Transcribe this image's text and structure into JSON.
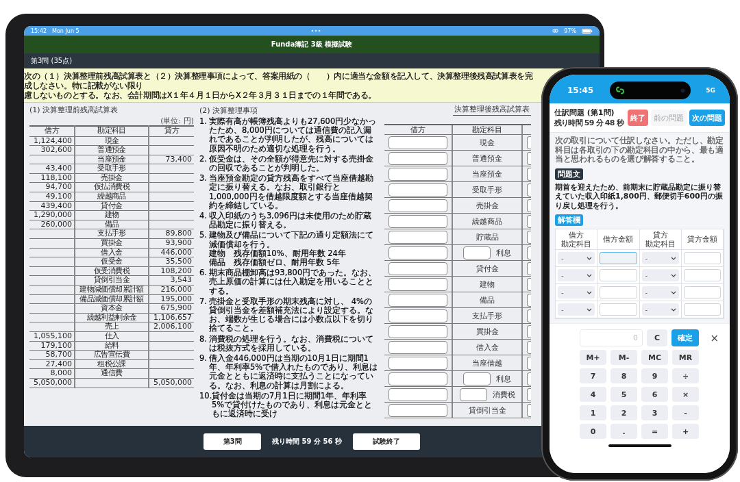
{
  "ipad": {
    "status_bar": {
      "time": "15:42",
      "date": "Mon Jun 5",
      "battery": "97%"
    },
    "app_title": "Funda簿記 3級 模擬試験",
    "section_title": "第3問 (35点)",
    "instructions": [
      "次の（１）決算整理前残高試算表と（２）決算整理事項によって、答案用紙の（　　）内に適当な金額を記入して、決算整理後残高試算表を完成しなさい。特に記載がない限り",
      "慮しないものとする。なお、会計期間はX１年４月１日からX２年３月３１日までの１年間である。"
    ],
    "trial_balance": {
      "title": "(1) 決算整理前残高試算表",
      "unit": "(単位: 円)",
      "columns": [
        "借方",
        "勘定科目",
        "貸方"
      ],
      "rows": [
        {
          "debit": "1,124,400",
          "account": "現金"
        },
        {
          "debit": "302,600",
          "account": "普通預金"
        },
        {
          "account": "当座預金",
          "credit": "73,400"
        },
        {
          "debit": "43,400",
          "account": "受取手形"
        },
        {
          "debit": "118,100",
          "account": "売掛金"
        },
        {
          "debit": "94,700",
          "account": "仮払消費税"
        },
        {
          "debit": "49,100",
          "account": "繰越商品"
        },
        {
          "debit": "439,400",
          "account": "貸付金"
        },
        {
          "debit": "1,290,000",
          "account": "建物"
        },
        {
          "debit": "260,000",
          "account": "備品"
        },
        {
          "account": "支払手形",
          "credit": "89,800"
        },
        {
          "account": "買掛金",
          "credit": "93,900"
        },
        {
          "account": "借入金",
          "credit": "446,000"
        },
        {
          "account": "仮受金",
          "credit": "35,500"
        },
        {
          "account": "仮受消費税",
          "credit": "108,200"
        },
        {
          "account": "貸倒引当金",
          "credit": "3,543"
        },
        {
          "account": "建物減価償却累計額",
          "credit": "216,000"
        },
        {
          "account": "備品減価償却累計額",
          "credit": "195,000"
        },
        {
          "account": "資本金",
          "credit": "675,900"
        },
        {
          "account": "繰越利益剰余金",
          "credit": "1,106,657"
        },
        {
          "account": "売上",
          "credit": "2,006,100"
        },
        {
          "debit": "1,055,100",
          "account": "仕入"
        },
        {
          "debit": "179,100",
          "account": "給料"
        },
        {
          "debit": "58,700",
          "account": "広告宣伝費"
        },
        {
          "debit": "27,400",
          "account": "租税公課"
        },
        {
          "debit": "8,000",
          "account": "通信費"
        },
        {
          "debit": "5,050,000",
          "credit": "5,050,000"
        }
      ]
    },
    "adjustments": {
      "title": "(2) 決算整理事項",
      "items": [
        {
          "number": "1.",
          "text": "実際有高が帳簿残高よりも27,600円少なかったため、8,000円については通信費の記入漏れであることが判明したが、残高については原因不明のため適切な処理を行う。"
        },
        {
          "number": "2.",
          "text": "仮受金は、その全額が得意先に対する売掛金の回収であることが判明した。"
        },
        {
          "number": "3.",
          "text": "当座預金勘定の貸方残高をすべて当座借越勘定に振り替える。なお、取引銀行と1,000,000円を借越限度額とする当座借越契約を締結している。"
        },
        {
          "number": "4.",
          "text": "収入印紙のうち3,096円は未使用のため貯蔵品勘定に振り替える。"
        },
        {
          "number": "5.",
          "text": "建物及び備品について下記の通り定額法にて減価償却を行う。",
          "details": [
            "建物　残存価額10%、耐用年数 24年",
            "備品　残存価額ゼロ、耐用年数 5年"
          ]
        },
        {
          "number": "6.",
          "text": "期末商品棚卸高は93,800円であった。なお、売上原価の計算には仕入勘定を用いることとする。"
        },
        {
          "number": "7.",
          "text": "売掛金と受取手形の期末残高に対し、 4%の貸倒引当金を差額補充法により設定する。なお、端数が生じる場合には小数点以下を切り捨てること。"
        },
        {
          "number": "8.",
          "text": "消費税の処理を行う。なお、消費税については税抜方式を採用している。"
        },
        {
          "number": "9.",
          "text": "借入金446,000円は当期の10月1日に期間1年、年利率5%で借入れたものであり、利息は元金とともに返済時に支払うことになっている。なお、利息の計算は月割による。"
        },
        {
          "number": "10.",
          "text": "貸付金は当期の7月1日に期間1年、年利率5%で貸付けたものであり、利息は元金とともに返済時に受け"
        }
      ]
    },
    "answer_sheet": {
      "title": "決算整理後残高試算表",
      "columns": [
        "借方",
        "勘定科目"
      ],
      "rows": [
        {
          "kind": "plain",
          "account": "現金"
        },
        {
          "kind": "plain",
          "account": "普通預金"
        },
        {
          "kind": "plain",
          "account": "当座預金"
        },
        {
          "kind": "plain",
          "account": "受取手形"
        },
        {
          "kind": "plain",
          "account": "売掛金"
        },
        {
          "kind": "plain",
          "account": "繰越商品"
        },
        {
          "kind": "plain",
          "account": "貯蔵品"
        },
        {
          "kind": "with_input",
          "account": "利息"
        },
        {
          "kind": "plain",
          "account": "貸付金"
        },
        {
          "kind": "plain",
          "account": "建物"
        },
        {
          "kind": "plain",
          "account": "備品"
        },
        {
          "kind": "plain",
          "account": "支払手形"
        },
        {
          "kind": "plain",
          "account": "買掛金"
        },
        {
          "kind": "plain",
          "account": "借入金"
        },
        {
          "kind": "plain",
          "account": "当座借越"
        },
        {
          "kind": "with_input",
          "account": "利息"
        },
        {
          "kind": "with_input",
          "account": "消費税"
        },
        {
          "kind": "plain",
          "account": "貸倒引当金"
        }
      ]
    },
    "footer": {
      "section_button": "第3問",
      "time_left": "残り時間 59 分 56 秒",
      "end_button": "試験終了"
    }
  },
  "iphone": {
    "status_bar": {
      "time": "15:45",
      "network": "5G"
    },
    "title": "仕訳問題 (第1問)",
    "time_left": "残り時間 59 分 48 秒",
    "buttons": [
      {
        "label": "終了",
        "kind": "danger",
        "disabled": false
      },
      {
        "label": "前の問題",
        "kind": "secondary",
        "disabled": true
      },
      {
        "label": "次の問題",
        "kind": "primary",
        "disabled": false
      }
    ],
    "instruction": "次の取引について仕訳しなさい。ただし、勘定科目は各取引の下の勘定科目の中から、最も適当と思われるものを選び解答すること。",
    "question_tag": "問題文",
    "question": "期首を迎えたため、前期末に貯蔵品勘定に振り替えていた収入印紙1,800円、郵便切手600円の振り戻し処理を行う。",
    "answer_tag": "解答欄",
    "answer_columns": [
      [
        "借方",
        "勘定科目"
      ],
      [
        "借方金額"
      ],
      [
        "貸方",
        "勘定科目"
      ],
      [
        "貸方金額"
      ]
    ],
    "answer_rows": [
      {
        "debit_account": "-",
        "debit_amount_focused": true,
        "credit_account": "-"
      },
      {
        "debit_account": "-",
        "debit_amount_focused": false,
        "credit_account": "-"
      },
      {
        "debit_account": "-",
        "debit_amount_focused": false,
        "credit_account": "-"
      },
      {
        "debit_account": "-",
        "debit_amount_focused": false,
        "credit_account": "-"
      }
    ],
    "calculator": {
      "display_placeholder": "0",
      "clear_key": "C",
      "confirm_key": "確定",
      "close": "×",
      "keys": [
        "M+",
        "M-",
        "MC",
        "MR",
        "7",
        "8",
        "9",
        "÷",
        "4",
        "5",
        "6",
        "×",
        "1",
        "2",
        "3",
        "-",
        "0",
        ".",
        "=",
        "+"
      ]
    }
  }
}
